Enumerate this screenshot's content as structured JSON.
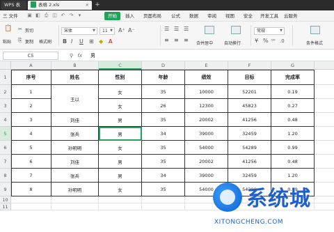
{
  "titlebar": {
    "home_tab": "WPS 表格",
    "doc_tab": "表格 2.xls",
    "close": "×",
    "add": "+"
  },
  "menu": {
    "file": "三 文件",
    "items": [
      "开始",
      "插入",
      "页面布局",
      "公式",
      "数据",
      "审阅",
      "视图",
      "安全",
      "开发工具",
      "云服务"
    ],
    "active": "开始"
  },
  "ribbon": {
    "cut": "剪切",
    "paste": "粘贴",
    "copy": "复制",
    "format_painter": "格式刷",
    "font_name": "宋体",
    "font_size": "11",
    "merge_center": "合并居中",
    "auto_wrap": "自动换行",
    "number_format": "常规",
    "conditional_format": "条件格式"
  },
  "formula_bar": {
    "cell_ref": "C5",
    "fx": "fx",
    "value": "男"
  },
  "grid": {
    "columns": [
      "A",
      "B",
      "C",
      "D",
      "E",
      "F",
      "G"
    ],
    "selected_column": "C",
    "row_numbers": [
      "1",
      "2",
      "3",
      "4",
      "5",
      "6",
      "7",
      "8",
      "9",
      "10",
      "11"
    ],
    "selected_row": "5",
    "headers": [
      "序号",
      "姓名",
      "性别",
      "年龄",
      "绩效",
      "目标",
      "完成率"
    ],
    "rows": [
      {
        "a": "1",
        "b": "王以",
        "c": "女",
        "d": "35",
        "e": "10000",
        "f": "52201",
        "g": "0.19"
      },
      {
        "a": "2",
        "b": "",
        "c": "女",
        "d": "26",
        "e": "12300",
        "f": "45823",
        "g": "0.27"
      },
      {
        "a": "3",
        "b": "刘佳",
        "c": "男",
        "d": "35",
        "e": "20002",
        "f": "41256",
        "g": "0.48"
      },
      {
        "a": "4",
        "b": "张兵",
        "c": "男",
        "d": "34",
        "e": "39000",
        "f": "32459",
        "g": "1.20"
      },
      {
        "a": "5",
        "b": "孙明明",
        "c": "女",
        "d": "35",
        "e": "54000",
        "f": "54289",
        "g": "0.99"
      },
      {
        "a": "6",
        "b": "刘佳",
        "c": "男",
        "d": "35",
        "e": "20002",
        "f": "41256",
        "g": "0.48"
      },
      {
        "a": "7",
        "b": "张兵",
        "c": "男",
        "d": "34",
        "e": "39000",
        "f": "32459",
        "g": "1.20"
      },
      {
        "a": "8",
        "b": "孙明明",
        "c": "女",
        "d": "35",
        "e": "54000",
        "f": "54289",
        "g": "0.99"
      }
    ]
  },
  "watermark": {
    "text": "系统城",
    "url": "XITONGCHENG.COM"
  }
}
